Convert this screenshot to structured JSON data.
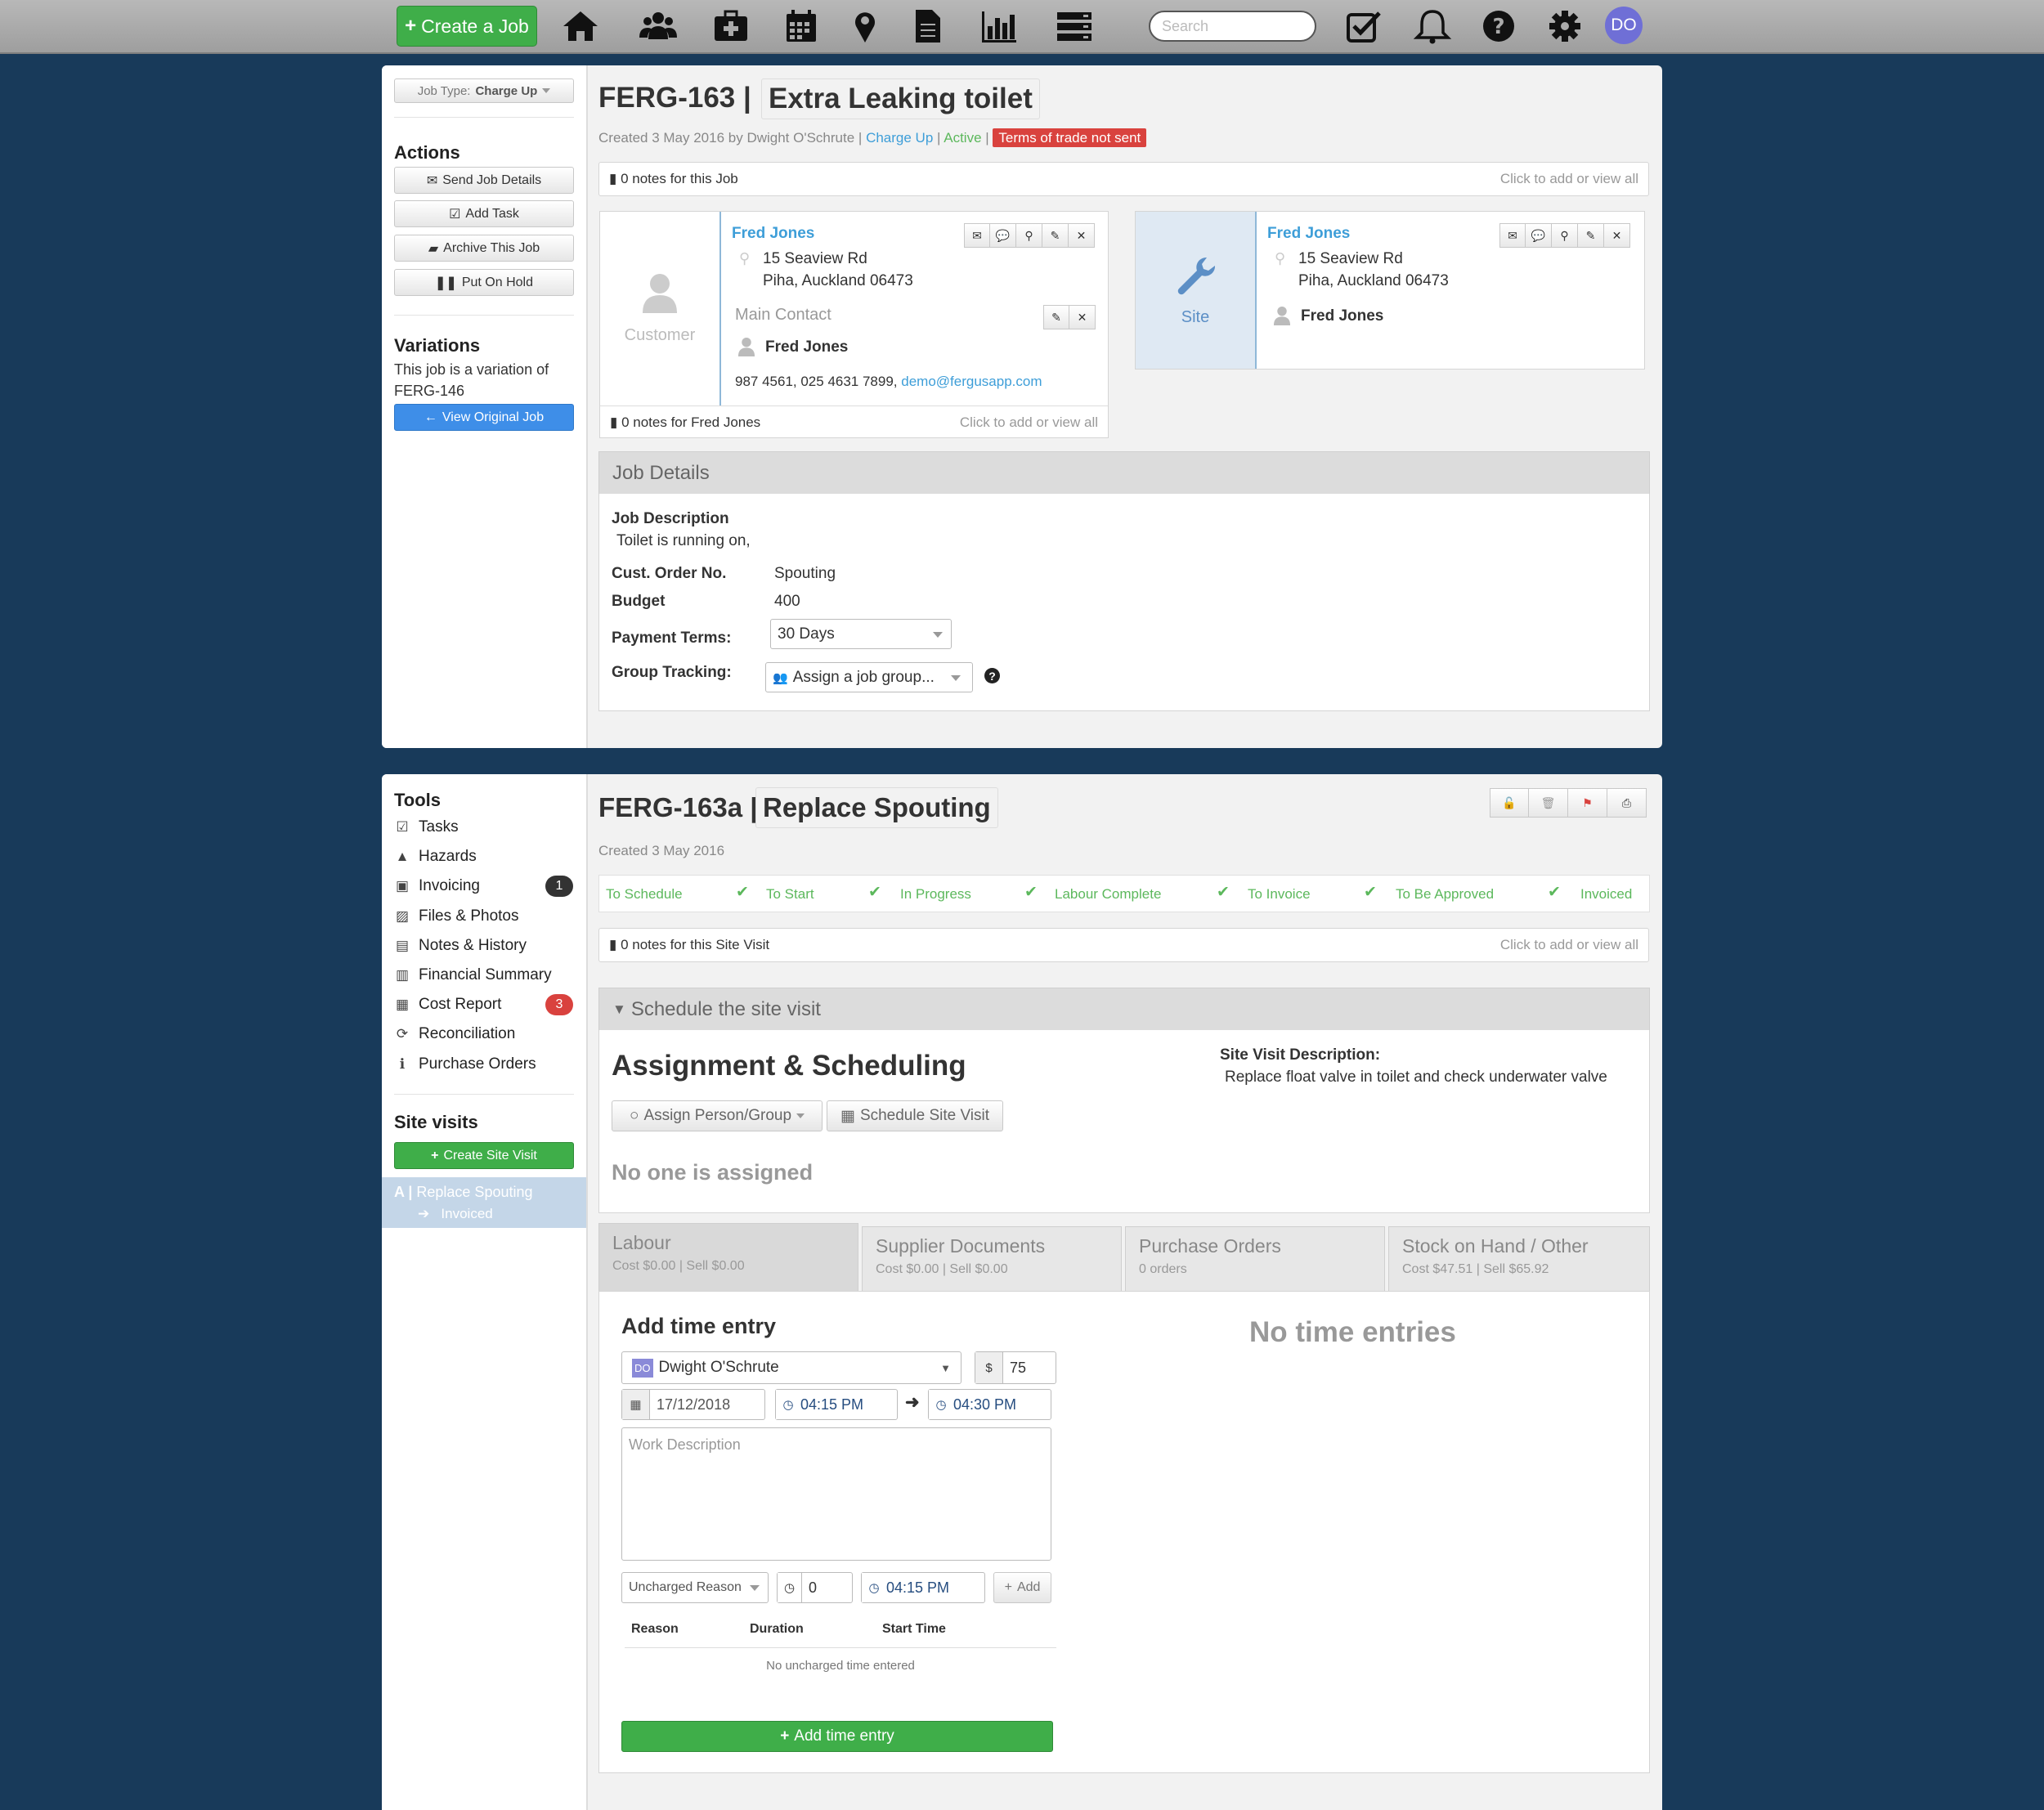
{
  "topbar": {
    "create_label": "Create a Job",
    "search_placeholder": "Search",
    "avatar_initials": "DO",
    "icons": [
      "home-icon",
      "users-icon",
      "medkit-icon",
      "calendar-icon",
      "map-marker-icon",
      "document-icon",
      "bar-chart-icon",
      "server-icon",
      "check-square-icon",
      "bell-icon",
      "question-icon",
      "gear-icon"
    ]
  },
  "job": {
    "job_type_label": "Job Type:",
    "job_type_value": "Charge Up",
    "actions_heading": "Actions",
    "actions": [
      "Send Job Details",
      "Add Task",
      "Archive This Job",
      "Put On Hold"
    ],
    "variations_heading": "Variations",
    "variations_text_1": "This job is a variation of",
    "variations_text_2": "FERG-146",
    "view_original_label": "View Original Job",
    "id": "FERG-163 |",
    "title": "Extra Leaking toilet",
    "created": "Created 3 May 2016 by Dwight O'Schrute |",
    "meta_type": "Charge Up",
    "meta_sep": "|",
    "meta_status": "Active",
    "meta_sep2": "|",
    "terms_badge": "Terms of trade not sent",
    "notes_label": "0 notes for this Job",
    "notes_action": "Click to add or view all",
    "customer": {
      "label": "Customer",
      "name": "Fred Jones",
      "address1": "15 Seaview Rd",
      "address2": "Piha, Auckland 06473",
      "main_contact_label": "Main Contact",
      "contact_name": "Fred Jones",
      "phones": "987 4561, 025 4631 7899,",
      "email": "demo@fergusapp.com",
      "notes_label": "0 notes for Fred Jones",
      "notes_action": "Click to add or view all"
    },
    "site": {
      "label": "Site",
      "name": "Fred Jones",
      "address1": "15 Seaview Rd",
      "address2": "Piha, Auckland 06473",
      "contact_name": "Fred Jones"
    },
    "details_heading": "Job Details",
    "desc_label": "Job Description",
    "desc_value": "Toilet is running on,",
    "order_label": "Cust. Order No.",
    "order_value": "Spouting",
    "budget_label": "Budget",
    "budget_value": "400",
    "payment_label": "Payment Terms:",
    "payment_value": "30 Days",
    "group_label": "Group Tracking:",
    "group_value": "Assign a job group..."
  },
  "visit": {
    "tools_heading": "Tools",
    "tools": [
      {
        "label": "Tasks",
        "icon": "check-square-icon"
      },
      {
        "label": "Hazards",
        "icon": "warning-icon"
      },
      {
        "label": "Invoicing",
        "icon": "money-icon",
        "badge": "1"
      },
      {
        "label": "Files & Photos",
        "icon": "image-icon"
      },
      {
        "label": "Notes & History",
        "icon": "document-icon"
      },
      {
        "label": "Financial Summary",
        "icon": "bar-chart-icon"
      },
      {
        "label": "Cost Report",
        "icon": "list-icon",
        "badge": "3"
      },
      {
        "label": "Reconciliation",
        "icon": "refresh-icon"
      },
      {
        "label": "Purchase Orders",
        "icon": "info-icon"
      }
    ],
    "site_visits_heading": "Site visits",
    "create_visit_label": "Create Site Visit",
    "visit_item_prefix": "A |",
    "visit_item_label": "Replace Spouting",
    "visit_item_status": "Invoiced",
    "id": "FERG-163a |",
    "title": "Replace Spouting",
    "created": "Created 3 May 2016",
    "statuses": [
      "To Schedule",
      "To Start",
      "In Progress",
      "Labour Complete",
      "To Invoice",
      "To Be Approved",
      "Invoiced"
    ],
    "notes_label": "0 notes for this Site Visit",
    "notes_action": "Click to add or view all",
    "schedule_heading": "Schedule the site visit",
    "assign_heading": "Assignment & Scheduling",
    "assign_btn": "Assign Person/Group",
    "schedule_btn": "Schedule Site Visit",
    "no_assign": "No one is assigned",
    "desc_label": "Site Visit Description:",
    "desc_value": "Replace float valve in toilet and check underwater valve",
    "tabs": [
      {
        "title": "Labour",
        "sub": "Cost $0.00 | Sell $0.00"
      },
      {
        "title": "Supplier Documents",
        "sub": "Cost $0.00 | Sell $0.00"
      },
      {
        "title": "Purchase Orders",
        "sub": "0 orders"
      },
      {
        "title": "Stock on Hand / Other",
        "sub": "Cost $47.51 | Sell $65.92"
      }
    ],
    "entry": {
      "heading": "Add time entry",
      "person_initials": "DO",
      "person": "Dwight O'Schrute",
      "currency": "$",
      "rate": "75",
      "date": "17/12/2018",
      "start": "04:15 PM",
      "end": "04:30 PM",
      "desc_placeholder": "Work Description",
      "uncharged_reason": "Uncharged Reason",
      "duration": "0",
      "uncharged_start": "04:15 PM",
      "add_small": "Add",
      "col_reason": "Reason",
      "col_duration": "Duration",
      "col_start": "Start Time",
      "empty_uncharged": "No uncharged time entered",
      "add_btn": "Add time entry"
    },
    "no_entries": "No time entries"
  }
}
